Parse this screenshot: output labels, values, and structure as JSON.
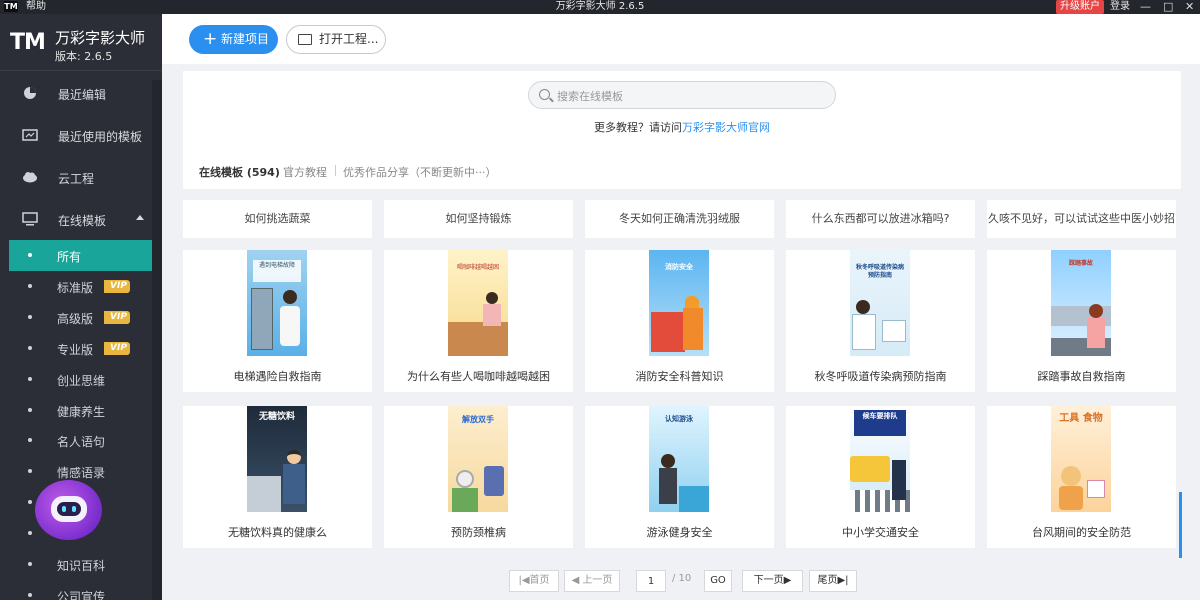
{
  "titlebar": {
    "logo": "TM",
    "help": "帮助",
    "title": "万彩字影大师 2.6.5",
    "upgrade": "升级账户",
    "login": "登录",
    "minimize": "—",
    "maximize": "□",
    "close": "✕"
  },
  "brand": {
    "logo": "TM",
    "name": "万彩字影大师",
    "version": "版本: 2.6.5"
  },
  "nav": {
    "recent_edit": "最近编辑",
    "recent_templates": "最近使用的模板",
    "cloud": "云工程",
    "online_templates": "在线模板"
  },
  "categories": [
    {
      "label": "所有",
      "vip": ""
    },
    {
      "label": "标准版",
      "vip": "VIP"
    },
    {
      "label": "高级版",
      "vip": "VIP"
    },
    {
      "label": "专业版",
      "vip": "VIP"
    },
    {
      "label": "创业思维",
      "vip": ""
    },
    {
      "label": "健康养生",
      "vip": ""
    },
    {
      "label": "名人语句",
      "vip": ""
    },
    {
      "label": "情感语录",
      "vip": ""
    },
    {
      "label": "",
      "vip": ""
    },
    {
      "label": "",
      "vip": ""
    },
    {
      "label": "知识百科",
      "vip": ""
    },
    {
      "label": "公司宣传",
      "vip": ""
    }
  ],
  "toolbar": {
    "new_project": "新建项目",
    "open_project": "打开工程..."
  },
  "search": {
    "placeholder": "搜索在线模板",
    "tutorial_prefix": "更多教程？请访问",
    "tutorial_link": "万彩字影大师官网"
  },
  "tabs": {
    "online": "在线模板 (594)",
    "official": "官方教程",
    "showcase": "优秀作品分享（不断更新中···）"
  },
  "tips": [
    "如何挑选蔬菜",
    "如何坚持锻炼",
    "冬天如何正确清洗羽绒服",
    "什么东西都可以放进冰箱吗?",
    "久咳不见好，可以试试这些中医小妙招"
  ],
  "templates_row1": [
    {
      "caption": "电梯遇险自救指南",
      "thumb_text": "遇到电梯故障"
    },
    {
      "caption": "为什么有些人喝咖啡越喝越困",
      "thumb_text": "喝咖啡越喝越困"
    },
    {
      "caption": "消防安全科普知识",
      "thumb_text": "消防安全"
    },
    {
      "caption": "秋冬呼吸道传染病预防指南",
      "thumb_text": "秋冬呼吸道传染病预防指南"
    },
    {
      "caption": "踩踏事故自救指南",
      "thumb_text": "踩踏事故"
    }
  ],
  "templates_row2": [
    {
      "caption": "无糖饮料真的健康么",
      "thumb_text": "无糖饮料"
    },
    {
      "caption": "预防颈椎病",
      "thumb_text": "解放双手"
    },
    {
      "caption": "游泳健身安全",
      "thumb_text": "认知游泳"
    },
    {
      "caption": "中小学交通安全",
      "thumb_text": "候车要排队"
    },
    {
      "caption": "台风期间的安全防范",
      "thumb_text": "工具 食物"
    }
  ],
  "pager": {
    "first": "|◀首页",
    "prev": "◀ 上一页",
    "current": "1",
    "total": "/ 10",
    "go": "GO",
    "next": "下一页▶",
    "last": "尾页▶|"
  },
  "colors": {
    "accent": "#2b8ff0",
    "sidebar": "#2b2e36",
    "active": "#1aa59a",
    "vip": "#e9b640",
    "upgrade": "#e64545"
  }
}
